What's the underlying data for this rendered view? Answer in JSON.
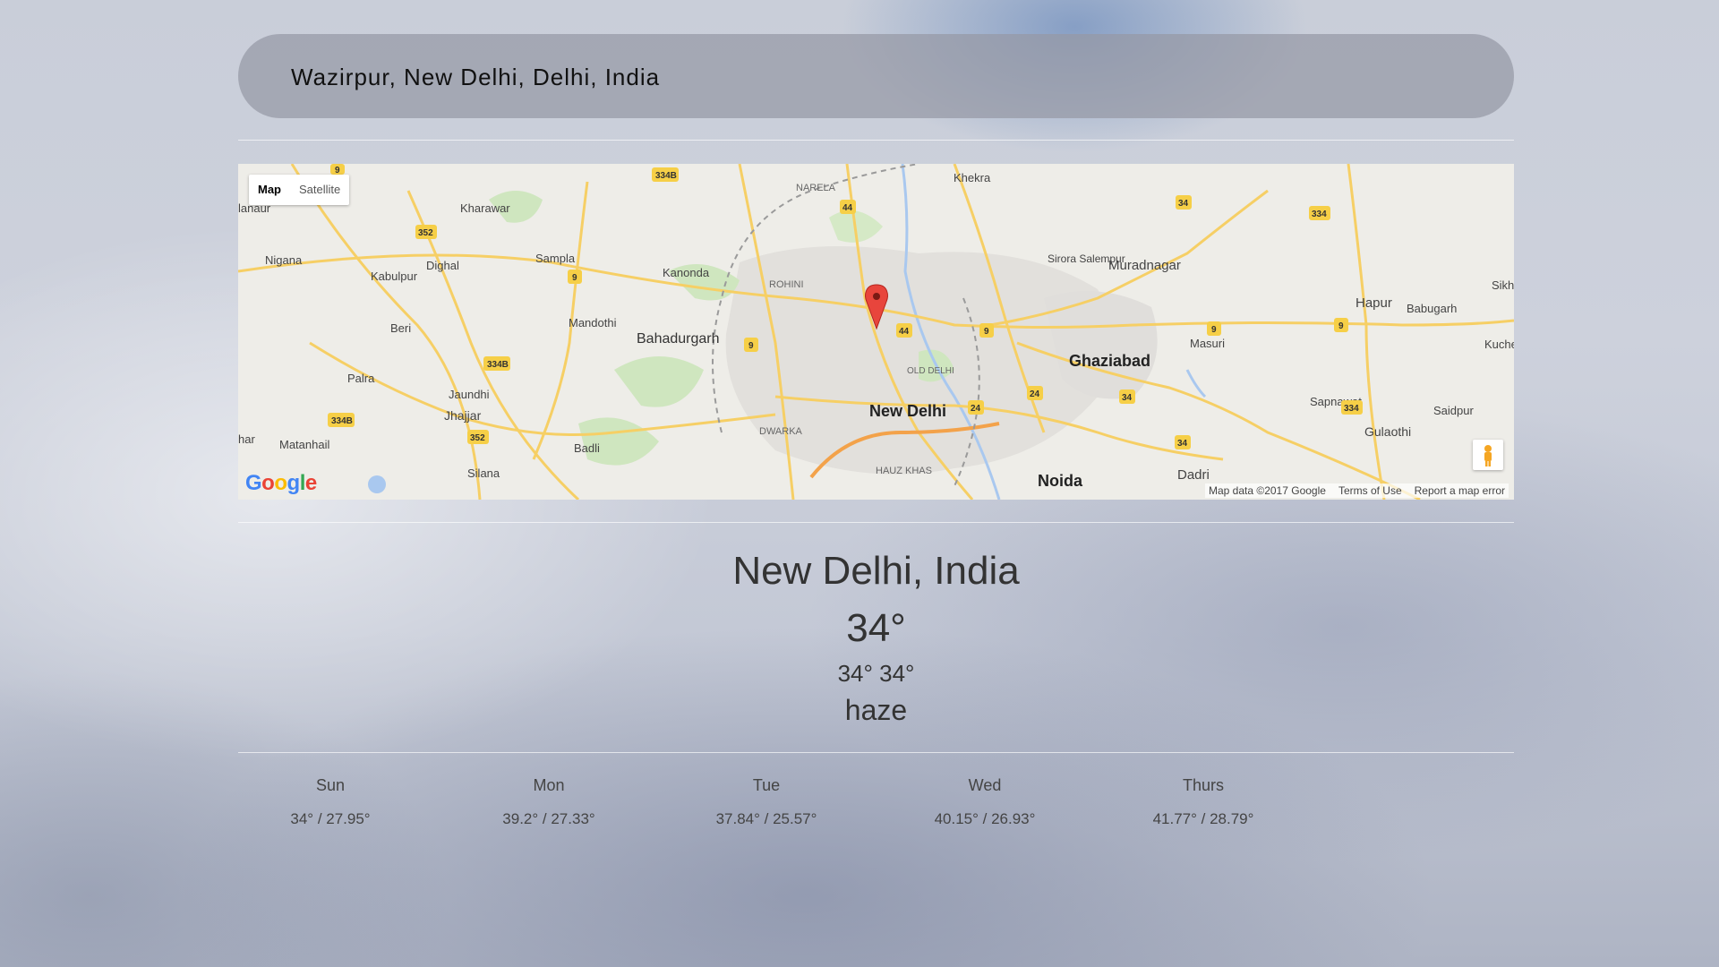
{
  "search": {
    "value": "Wazirpur, New Delhi, Delhi, India"
  },
  "map": {
    "type_buttons": [
      "Map",
      "Satellite"
    ],
    "logo": "Google",
    "links": [
      "Map data ©2017 Google",
      "Terms of Use",
      "Report a map error"
    ],
    "labels": {
      "new_delhi": "New Delhi",
      "ghaziabad": "Ghaziabad",
      "noida": "Noida",
      "bahadurgarh": "Bahadurgarh",
      "rohini": "ROHINI",
      "dwarka": "DWARKA",
      "old_delhi": "OLD DELHI",
      "hauz_khas": "HAUZ KHAS",
      "narela": "NARELA",
      "kharawar": "Kharawar",
      "nigana": "Nigana",
      "kabulpur": "Kabulpur",
      "dighal": "Dighal",
      "sampla": "Sampla",
      "kanonda": "Kanonda",
      "mandothi": "Mandothi",
      "beri": "Beri",
      "palra": "Palra",
      "jaundhi": "Jaundhi",
      "jhajjar": "Jhajjar",
      "matanhail": "Matanhail",
      "badli": "Badli",
      "silana": "Silana",
      "khekra": "Khekra",
      "sirora_salempur": "Sirora Salempur",
      "muradnagar": "Muradnagar",
      "hapur": "Hapur",
      "babugarh": "Babugarh",
      "masuri": "Masuri",
      "sapnawat": "Sapnawat",
      "gulaothi": "Gulaothi",
      "saidpur": "Saidpur",
      "dadri": "Dadri",
      "kuche": "Kuche",
      "sikh": "Sikh",
      "lanaur": "lanaur",
      "har": "har"
    }
  },
  "current": {
    "city": "New Delhi, India",
    "temp": "34°",
    "hilo": "34° 34°",
    "description": "haze"
  },
  "forecast": [
    {
      "day": "Sun",
      "range": "34° / 27.95°"
    },
    {
      "day": "Mon",
      "range": "39.2° / 27.33°"
    },
    {
      "day": "Tue",
      "range": "37.84° / 25.57°"
    },
    {
      "day": "Wed",
      "range": "40.15° / 26.93°"
    },
    {
      "day": "Thurs",
      "range": "41.77° / 28.79°"
    }
  ],
  "colors": {
    "pin": "#e8453c",
    "road": "#f6cf65",
    "water": "#a9c8ef"
  }
}
